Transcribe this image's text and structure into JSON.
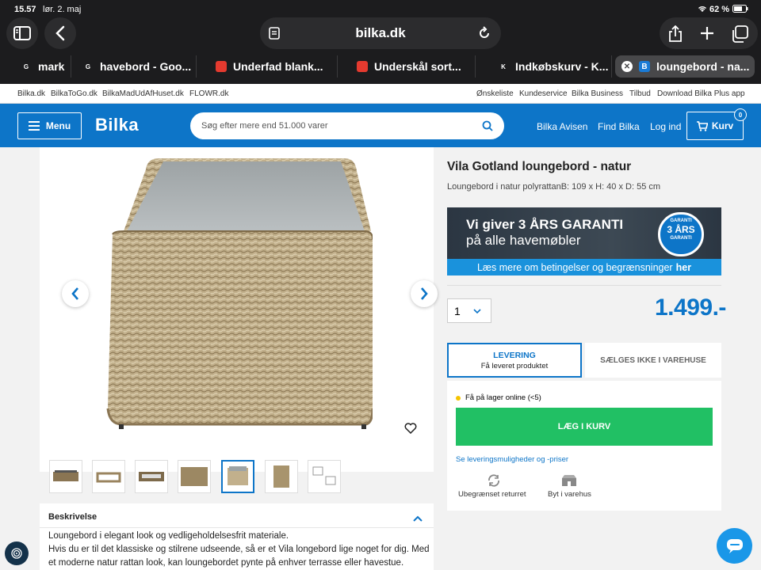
{
  "status": {
    "time": "15.57",
    "date": "lør. 2. maj",
    "battery": "62 %"
  },
  "browser": {
    "address": "bilka.dk",
    "icons": [
      "sidebar-icon",
      "back-icon",
      "reader-icon",
      "reload-icon",
      "share-icon",
      "plus-icon",
      "tabs-icon"
    ],
    "tabs": [
      {
        "favicon": "G",
        "label": "mark"
      },
      {
        "favicon": "G",
        "label": "havebord - Goo..."
      },
      {
        "favicon": "bilka",
        "label": "Underfad blank..."
      },
      {
        "favicon": "bilka",
        "label": "Underskål sort..."
      },
      {
        "favicon": "K",
        "label": "Indkøbskurv - K..."
      },
      {
        "favicon": "B",
        "label": "loungebord - na..."
      }
    ]
  },
  "toplinks": {
    "left": [
      "Bilka.dk",
      "BilkaToGo.dk",
      "BilkaMadUdAfHuset.dk",
      "FLOWR.dk"
    ],
    "right": [
      "Ønskeliste",
      "Kundeservice",
      "Bilka Business",
      "Tilbud",
      "Download Bilka Plus app"
    ]
  },
  "header": {
    "menu": "Menu",
    "logo": "Bilka",
    "search_placeholder": "Søg efter mere end 51.000 varer",
    "links": [
      "Bilka Avisen",
      "Find Bilka",
      "Log ind"
    ],
    "cart": "Kurv",
    "cart_count": "0",
    "brand_color": "#0d75c8"
  },
  "product": {
    "title": "Vila Gotland loungebord - natur",
    "subtitle": "Loungebord i natur polyrattanB: 109 x H: 40 x D: 55 cm",
    "promo_line1": "Vi giver 3 ÅRS GARANTI",
    "promo_line2": "på alle havemøbler",
    "promo_strip": "Læs mere om betingelser og begrænsninger",
    "promo_strip_link": "her",
    "promo_seal_top": "GARANTI",
    "promo_seal_mid": "3 ÅRS",
    "promo_seal_bottom": "GARANTI",
    "qty": "1",
    "price": "1.499.-",
    "delivery_title": "LEVERING",
    "delivery_sub": "Få leveret produktet",
    "store_label": "SÆLGES IKKE I VAREHUSE",
    "stock": "Få på lager online (<5)",
    "stock_color": "#f5c400",
    "add_to_cart": "LÆG I KURV",
    "cta_color": "#21c064",
    "delivery_link": "Se leveringsmuligheder og -priser",
    "returns": "Ubegrænset returret",
    "exchange": "Byt i varehus"
  },
  "description": {
    "heading": "Beskrivelse",
    "lines": [
      "Loungebord i elegant look og vedligeholdelsesfrit materiale.",
      "Hvis du er til det klassiske og stilrene udseende, så er et Vila longebord lige noget for dig. Med",
      "et moderne natur rattan look, kan loungebordet pynte på enhver terrasse eller havestue."
    ]
  }
}
